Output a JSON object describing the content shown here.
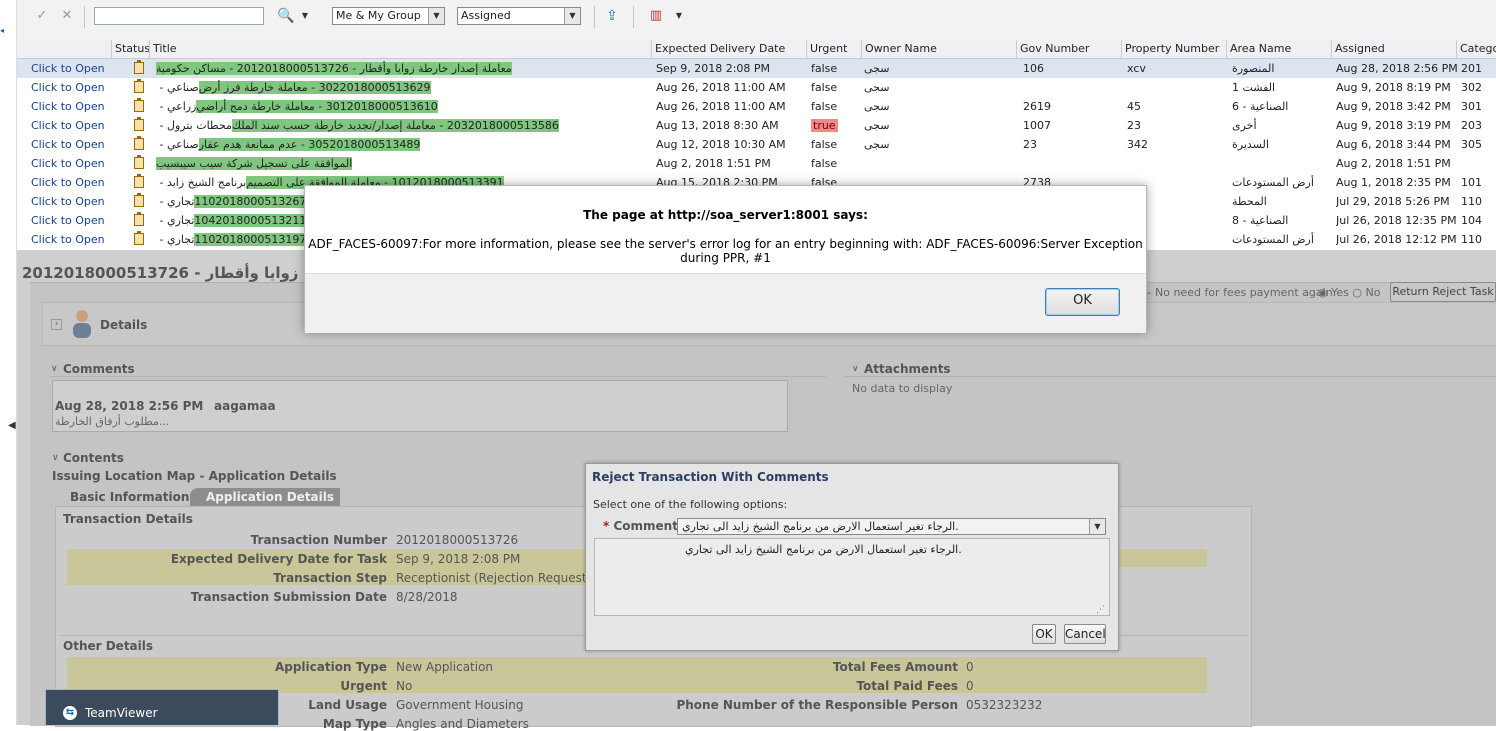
{
  "toolbar": {
    "search_value": "",
    "filter_group": "Me & My Group",
    "filter_state": "Assigned"
  },
  "columns": [
    "Status",
    "Title",
    "Expected Delivery Date",
    "Urgent",
    "Owner Name",
    "Gov Number",
    "Property Number",
    "Area Name",
    "Assigned",
    "Categor"
  ],
  "rows": [
    {
      "open": "Click to Open",
      "title_pre": "",
      "title_hl": "معاملة إصدار خارطة زوايا وأقطار - 2012018000513726 - مساكن حكومية",
      "title_post": "",
      "date": "Sep 9, 2018 2:08 PM",
      "urgent": "false",
      "owner": "سجى",
      "gov": "106",
      "prop": "xcv",
      "area": "المنصورة",
      "assigned": "Aug 28, 2018 2:56 PM",
      "cat": "201"
    },
    {
      "open": "Click to Open",
      "title_pre": "صناعي - ",
      "title_hl": "3022018000513629 - معاملة خارطة فرز أرض",
      "title_post": "",
      "date": "Aug 26, 2018 11:00 AM",
      "urgent": "false",
      "owner": "سجى",
      "gov": "",
      "prop": "",
      "area": "الفشت 1",
      "assigned": "Aug 9, 2018 8:19 PM",
      "cat": "302"
    },
    {
      "open": "Click to Open",
      "title_pre": "زراعي - ",
      "title_hl": "3012018000513610 - معاملة خارطة دمج أراضي",
      "title_post": "",
      "date": "Aug 26, 2018 11:00 AM",
      "urgent": "false",
      "owner": "سجى",
      "gov": "2619",
      "prop": "45",
      "area": "الصناعية - 6",
      "assigned": "Aug 9, 2018 3:42 PM",
      "cat": "301"
    },
    {
      "open": "Click to Open",
      "title_pre": "محطات بترول - ",
      "title_hl": "2032018000513586 - معاملة إصدار/تجديد خارطة حسب سند الملك",
      "title_post": "",
      "date": "Aug 13, 2018 8:30 AM",
      "urgent": "true",
      "owner": "سجى",
      "gov": "1007",
      "prop": "23",
      "area": "أخرى",
      "assigned": "Aug 9, 2018 3:19 PM",
      "cat": "203"
    },
    {
      "open": "Click to Open",
      "title_pre": "صناعي - ",
      "title_hl": "3052018000513489 - عدم ممانعة هدم عقار",
      "title_post": "",
      "date": "Aug 12, 2018 10:30 AM",
      "urgent": "false",
      "owner": "سجى",
      "gov": "23",
      "prop": "342",
      "area": "السديرة",
      "assigned": "Aug 6, 2018 3:44 PM",
      "cat": "305"
    },
    {
      "open": "Click to Open",
      "title_pre": "",
      "title_hl": "الموافقة على تسجيل شركة سيب سيبسيب",
      "title_post": "",
      "date": "Aug 2, 2018 1:51 PM",
      "urgent": "false",
      "owner": "",
      "gov": "",
      "prop": "",
      "area": "",
      "assigned": "Aug 2, 2018 1:51 PM",
      "cat": ""
    },
    {
      "open": "Click to Open",
      "title_pre": "برنامج الشيخ زايد - ",
      "title_hl": "1012018000513391 - معاملة الموافقة على التصميم",
      "title_post": "",
      "date": "Aug 15, 2018 2:30 PM",
      "urgent": "false",
      "owner": "",
      "gov": "2738",
      "prop": "",
      "area": "أرض المستودعات",
      "assigned": "Aug 1, 2018 2:35 PM",
      "cat": "101"
    },
    {
      "open": "Click to Open",
      "title_pre": "تجاري - ",
      "title_hl": "1102018000513267 - ",
      "title_post": "",
      "date": "",
      "urgent": "",
      "owner": "",
      "gov": "",
      "prop": "",
      "area": "المحطة",
      "assigned": "Jul 29, 2018 5:26 PM",
      "cat": "110"
    },
    {
      "open": "Click to Open",
      "title_pre": "تجاري - ",
      "title_hl": "1042018000513211 - ",
      "title_post": "",
      "date": "",
      "urgent": "",
      "owner": "",
      "gov": "",
      "prop": "",
      "area": "الصناعية - 8",
      "assigned": "Jul 26, 2018 12:35 PM",
      "cat": "104"
    },
    {
      "open": "Click to Open",
      "title_pre": "تجاري - ",
      "title_hl": "1102018000513197 - ",
      "title_post": "",
      "date": "",
      "urgent": "",
      "owner": "",
      "gov": "",
      "prop": "",
      "area": "أرض المستودعات",
      "assigned": "Jul 26, 2018 12:12 PM",
      "cat": "110"
    }
  ],
  "task": {
    "title": "2012018000513726 - حارطة زوايا وأقطار",
    "fees_label": "No need for fees payment again",
    "radio_yes": "Yes",
    "radio_no": "No",
    "return_reject": "Return Reject Task"
  },
  "details": {
    "label": "Details"
  },
  "comments": {
    "header": "Comments",
    "date": "Aug 28, 2018 2:56 PM",
    "user": "aagamaa",
    "text": "مطلوب أرفاق الخارطة..."
  },
  "attachments": {
    "header": "Attachments",
    "empty": "No data to display"
  },
  "contents": {
    "header": "Contents",
    "subtitle": "Issuing Location Map - Application Details",
    "tab_basic": "Basic Information",
    "tab_app": "Application Details",
    "transaction_header": "Transaction Details",
    "fields": [
      {
        "label": "Transaction Number",
        "value": "2012018000513726"
      },
      {
        "label": "Expected Delivery Date for Task",
        "value": "Sep 9, 2018 2:08 PM"
      },
      {
        "label": "Transaction Step",
        "value": "Receptionist (Rejection Request)"
      },
      {
        "label": "Transaction Submission Date",
        "value": "8/28/2018"
      }
    ],
    "other_header": "Other Details",
    "other_left": [
      {
        "label": "Application Type",
        "value": "New Application"
      },
      {
        "label": "Urgent",
        "value": "No"
      },
      {
        "label": "Land Usage",
        "value": "Government Housing"
      },
      {
        "label": "Map Type",
        "value": "Angles and Diameters"
      }
    ],
    "other_right": [
      {
        "label": "Total Fees Amount",
        "value": "0"
      },
      {
        "label": "Total Paid Fees",
        "value": "0"
      },
      {
        "label": "Phone Number of the Responsible Person",
        "value": "0532323232"
      }
    ]
  },
  "reject_dialog": {
    "title": "Reject Transaction With Comments",
    "prompt": "Select one of the following options:",
    "comments_label": "* Comments",
    "selected": ".الرجاء تغير استعمال الارض من برنامج الشيخ زايد الى تجاري",
    "text": ".الرجاء تغير استعمال الارض من برنامج الشيخ زايد الى تجاري",
    "ok": "OK",
    "cancel": "Cancel"
  },
  "alert": {
    "title": "The page at http://soa_server1:8001 says:",
    "message": "ADF_FACES-60097:For more information, please see the server's error log for an entry beginning with: ADF_FACES-60096:Server Exception during PPR, #1",
    "ok": "OK"
  },
  "teamviewer": {
    "label": "TeamViewer"
  }
}
